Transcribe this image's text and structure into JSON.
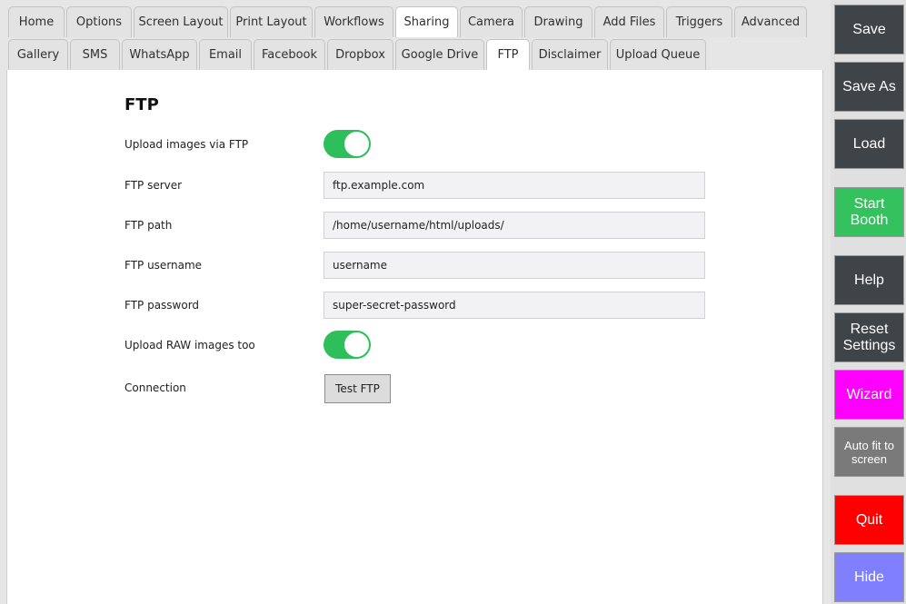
{
  "tabs_row1": [
    {
      "label": "Home",
      "active": false
    },
    {
      "label": "Options",
      "active": false
    },
    {
      "label": "Screen Layout",
      "active": false
    },
    {
      "label": "Print Layout",
      "active": false
    },
    {
      "label": "Workflows",
      "active": false
    },
    {
      "label": "Sharing",
      "active": true
    },
    {
      "label": "Camera",
      "active": false
    },
    {
      "label": "Drawing",
      "active": false
    },
    {
      "label": "Add Files",
      "active": false
    },
    {
      "label": "Triggers",
      "active": false
    },
    {
      "label": "Advanced",
      "active": false
    }
  ],
  "tabs_row2": [
    {
      "label": "Gallery",
      "active": false
    },
    {
      "label": "SMS",
      "active": false
    },
    {
      "label": "WhatsApp",
      "active": false
    },
    {
      "label": "Email",
      "active": false
    },
    {
      "label": "Facebook",
      "active": false
    },
    {
      "label": "Dropbox",
      "active": false
    },
    {
      "label": "Google Drive",
      "active": false
    },
    {
      "label": "FTP",
      "active": true
    },
    {
      "label": "Disclaimer",
      "active": false
    },
    {
      "label": "Upload Queue",
      "active": false
    }
  ],
  "ftp": {
    "title": "FTP",
    "upload_images": {
      "label": "Upload images via FTP",
      "enabled": true
    },
    "server": {
      "label": "FTP server",
      "value": "ftp.example.com"
    },
    "path": {
      "label": "FTP path",
      "value": "/home/username/html/uploads/"
    },
    "username": {
      "label": "FTP username",
      "value": "username"
    },
    "password": {
      "label": "FTP password",
      "value": "super-secret-password"
    },
    "upload_raw": {
      "label": "Upload RAW images too",
      "enabled": true
    },
    "connection": {
      "label": "Connection",
      "button_label": "Test FTP"
    },
    "toggle_color": "#2fbf5a"
  },
  "sidebar": {
    "save": {
      "label": "Save",
      "color": "#3f4449"
    },
    "save_as": {
      "label": "Save As",
      "color": "#3f4449"
    },
    "load": {
      "label": "Load",
      "color": "#3f4449"
    },
    "start_booth": {
      "label": "Start Booth",
      "color": "#33c25d"
    },
    "help": {
      "label": "Help",
      "color": "#3f4449"
    },
    "reset_settings": {
      "label": "Reset Settings",
      "color": "#3f4449"
    },
    "wizard": {
      "label": "Wizard",
      "color": "#ff00ff"
    },
    "auto_fit": {
      "label": "Auto fit to screen",
      "color": "#7a7a7a"
    },
    "quit": {
      "label": "Quit",
      "color": "#ff0000"
    },
    "hide": {
      "label": "Hide",
      "color": "#8080ff"
    }
  }
}
